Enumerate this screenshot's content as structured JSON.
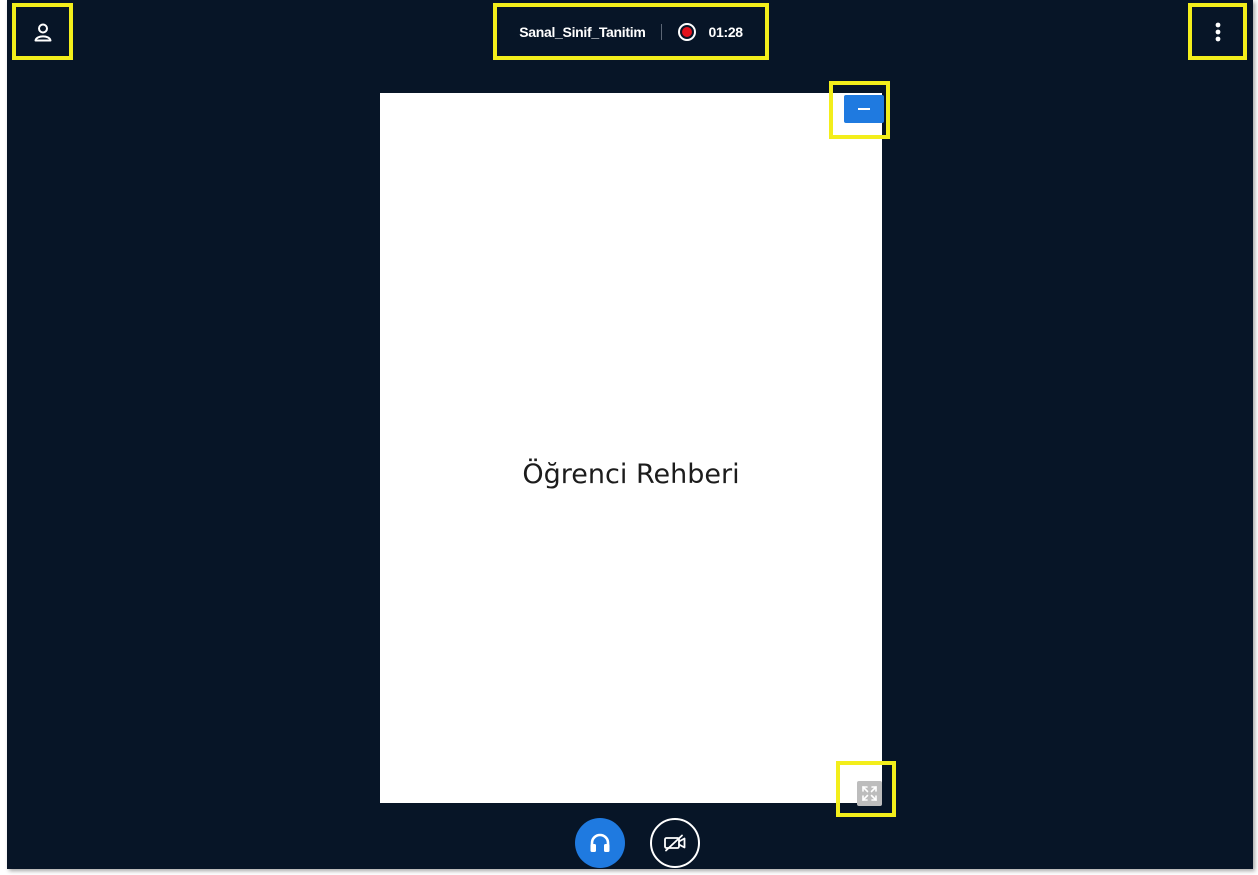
{
  "session": {
    "name": "Sanal_Sinif_Tanitim",
    "timer": "01:28",
    "recording": true
  },
  "slide": {
    "title": "Öğrenci Rehberi"
  },
  "icons": {
    "user": "user-icon",
    "menu": "more-vertical-icon",
    "record": "record-icon",
    "minimize": "minimize-icon",
    "fullscreen": "fullscreen-icon",
    "audio": "headphones-icon",
    "video": "video-off-icon"
  },
  "colors": {
    "background": "#071527",
    "accent": "#1f7ae0",
    "highlight": "#f3ee1b",
    "record": "#e1111b"
  }
}
